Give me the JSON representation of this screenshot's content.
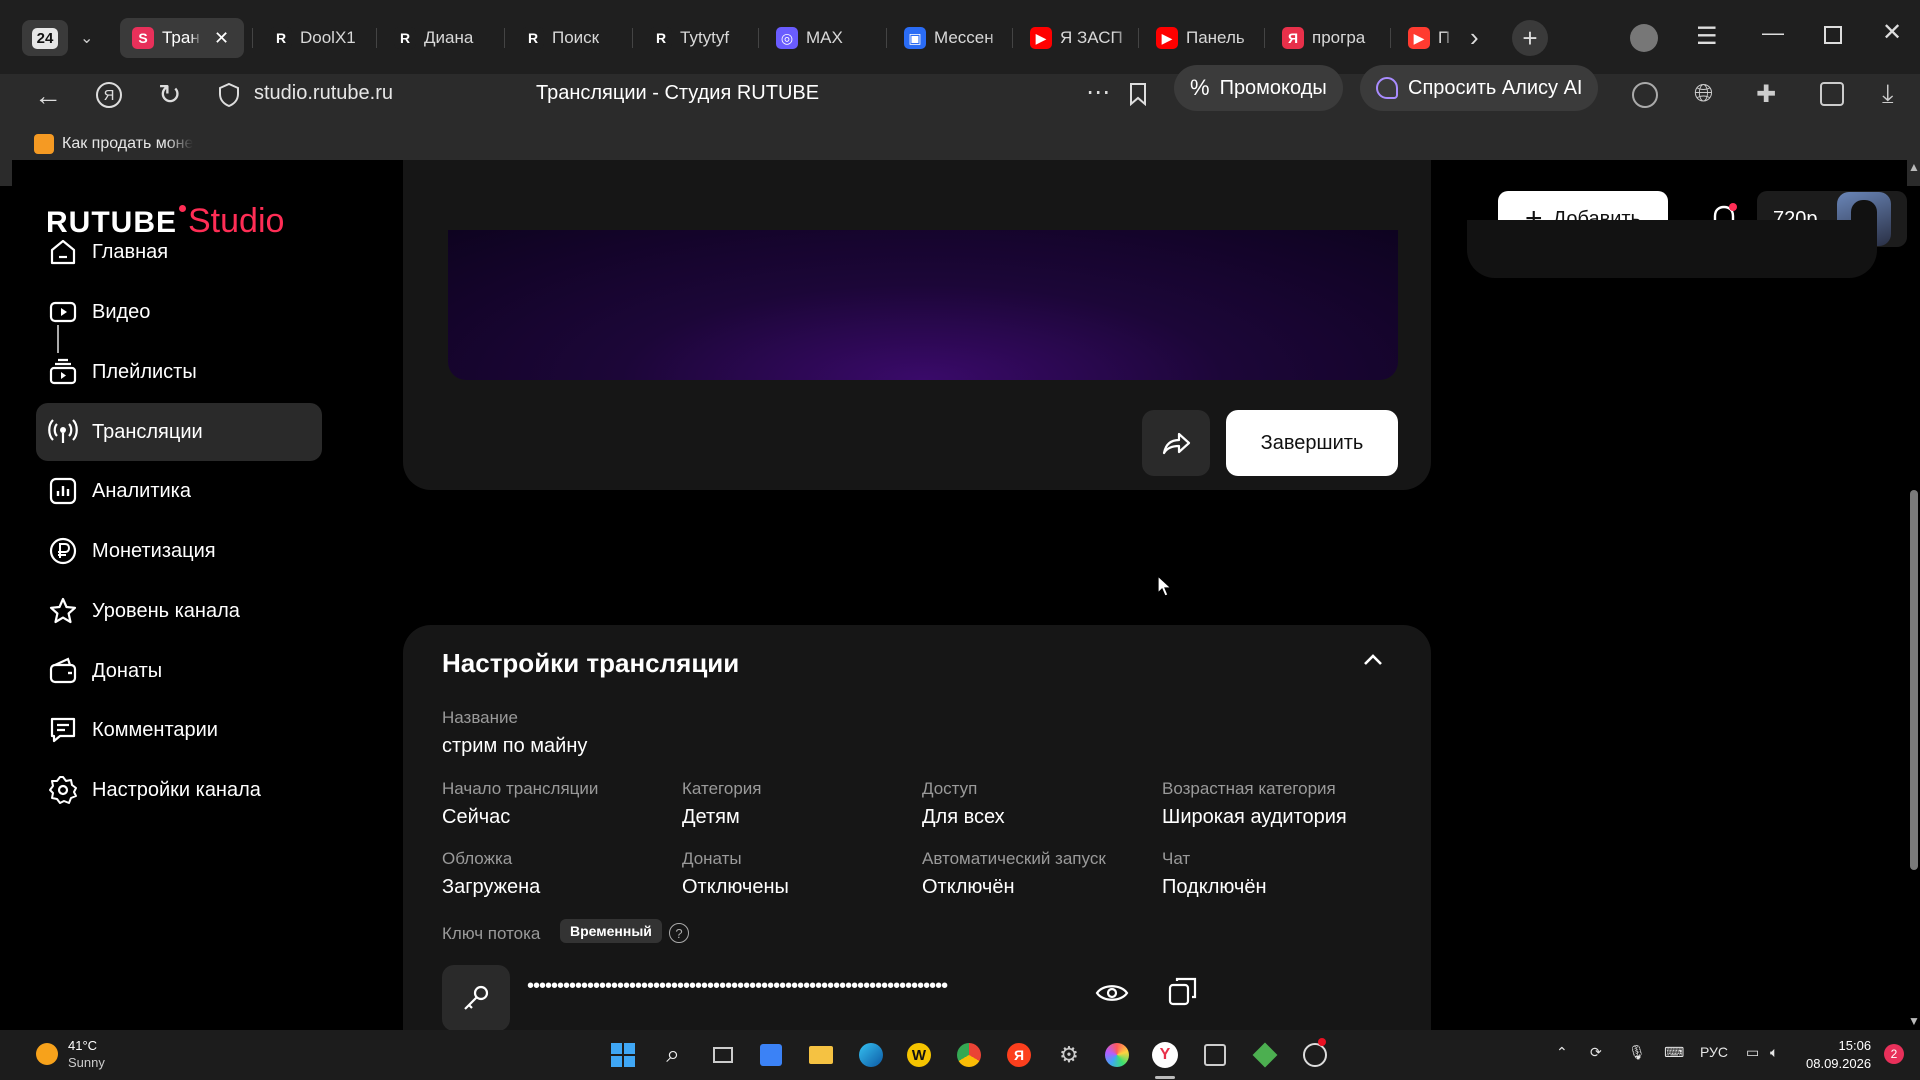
{
  "browser": {
    "tab_counter": "24",
    "tabs": [
      {
        "label": "Тран",
        "favicon": "S",
        "color": "#e8305a"
      },
      {
        "label": "DoolX1",
        "favicon": "R",
        "color": "#1f1f1f"
      },
      {
        "label": "Диана",
        "favicon": "R",
        "color": "#1f1f1f"
      },
      {
        "label": "Поиск",
        "favicon": "R",
        "color": "#1f1f1f"
      },
      {
        "label": "Tytytyf",
        "favicon": "R",
        "color": "#1f1f1f"
      },
      {
        "label": "MAX",
        "favicon": "◎",
        "color": "#6a5cff"
      },
      {
        "label": "Мессен",
        "favicon": "▣",
        "color": "#2a6cf5"
      },
      {
        "label": "Я ЗАСП",
        "favicon": "▶",
        "color": "#ff0000"
      },
      {
        "label": "Панель",
        "favicon": "▶",
        "color": "#ff0000"
      },
      {
        "label": "програ",
        "favicon": "Я",
        "color": "#e8304a"
      },
      {
        "label": "Пр",
        "favicon": "▶",
        "color": "#ff3b30"
      }
    ],
    "url": "studio.rutube.ru",
    "page_title": "Трансляции - Студия RUTUBE",
    "promo_label": "Промокоды",
    "alice_label": "Спросить Алису AI",
    "bookmark_label": "Как продать моне"
  },
  "header": {
    "logo_main": "RUTUBE",
    "logo_sub": "Studio",
    "add_label": "Добавить",
    "quality": "720p"
  },
  "sidebar": {
    "items": [
      {
        "label": "Главная",
        "icon": "home-icon"
      },
      {
        "label": "Видео",
        "icon": "video-icon"
      },
      {
        "label": "Плейлисты",
        "icon": "playlist-icon"
      },
      {
        "label": "Трансляции",
        "icon": "broadcast-icon"
      },
      {
        "label": "Аналитика",
        "icon": "analytics-icon"
      },
      {
        "label": "Монетизация",
        "icon": "ruble-icon"
      },
      {
        "label": "Уровень канала",
        "icon": "star-icon"
      },
      {
        "label": "Донаты",
        "icon": "wallet-icon"
      },
      {
        "label": "Комментарии",
        "icon": "comment-icon"
      },
      {
        "label": "Настройки канала",
        "icon": "gear-icon"
      }
    ]
  },
  "stream": {
    "finish_label": "Завершить"
  },
  "settings": {
    "title": "Настройки трансляции",
    "name_label": "Название",
    "name_value": "стрим по майну",
    "fields": [
      {
        "label": "Начало трансляции",
        "value": "Сейчас"
      },
      {
        "label": "Категория",
        "value": "Детям"
      },
      {
        "label": "Доступ",
        "value": "Для всех"
      },
      {
        "label": "Возрастная категория",
        "value": "Широкая аудитория"
      },
      {
        "label": "Обложка",
        "value": "Загружена"
      },
      {
        "label": "Донаты",
        "value": "Отключены"
      },
      {
        "label": "Автоматический запуск",
        "value": "Отключён"
      },
      {
        "label": "Чат",
        "value": "Подключён"
      }
    ],
    "key_label": "Ключ потока",
    "key_badge": "Временный",
    "key_masked": "••••••••••••••••••••••••••••••••••••••••••••••••••••••••••••••••••••••"
  },
  "taskbar": {
    "weather_temp": "41°C",
    "weather_text": "Sunny",
    "lang": "РУС",
    "time": "15:06",
    "date": "08.09.2026",
    "notif_count": "2"
  },
  "colors": {
    "accent": "#e8305a",
    "brand_studio": "#ff2d55"
  }
}
